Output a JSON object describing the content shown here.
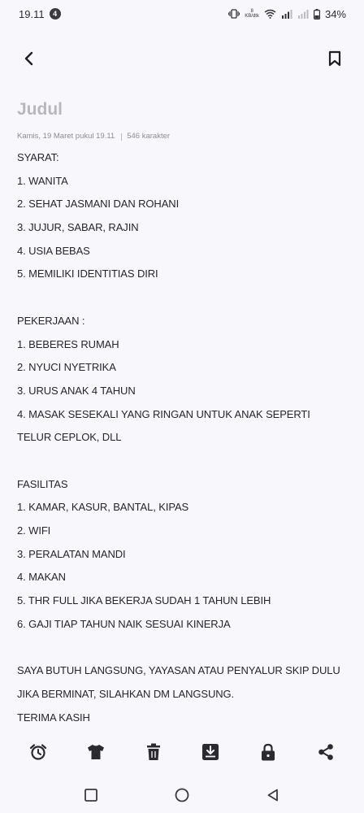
{
  "status": {
    "time": "19.11",
    "notif_count": "4",
    "net_speed_value": "8",
    "net_speed_unit": "KB/dtk",
    "battery": "34%"
  },
  "note": {
    "title": "Judul",
    "date": "Kamis, 19 Maret pukul 19.11",
    "chars": "546 karakter",
    "lines": [
      "SYARAT:",
      "1. WANITA",
      "2. SEHAT JASMANI DAN ROHANI",
      "3. JUJUR, SABAR, RAJIN",
      "4. USIA BEBAS",
      "5. MEMILIKI IDENTITIAS DIRI",
      "",
      "PEKERJAAN :",
      "1. BEBERES RUMAH",
      "2. NYUCI NYETRIKA",
      "3. URUS ANAK 4 TAHUN",
      "4. MASAK SESEKALI YANG RINGAN UNTUK ANAK SEPERTI",
      "TELUR CEPLOK, DLL",
      "",
      "FASILITAS",
      "1. KAMAR, KASUR, BANTAL, KIPAS",
      "2. WIFI",
      "3. PERALATAN MANDI",
      "4. MAKAN",
      "5. THR FULL JIKA BEKERJA SUDAH 1 TAHUN LEBIH",
      "6. GAJI TIAP TAHUN NAIK SESUAI KINERJA",
      "",
      "SAYA BUTUH LANGSUNG, YAYASAN ATAU PENYALUR SKIP DULU",
      "JIKA BERMINAT, SILAHKAN DM LANGSUNG.",
      "TERIMA KASIH"
    ]
  },
  "icons": {
    "back": "back-arrow-icon",
    "bookmark": "bookmark-icon",
    "toolbar": [
      "alarm-icon",
      "shirt-icon",
      "trash-icon",
      "download-icon",
      "lock-icon",
      "share-icon"
    ],
    "nav": [
      "recents-icon",
      "home-icon",
      "back-icon"
    ]
  },
  "colors": {
    "background": "#f8f7fb",
    "text": "#26262b",
    "title_placeholder": "#b8b7bd",
    "meta": "#8e8d93"
  }
}
